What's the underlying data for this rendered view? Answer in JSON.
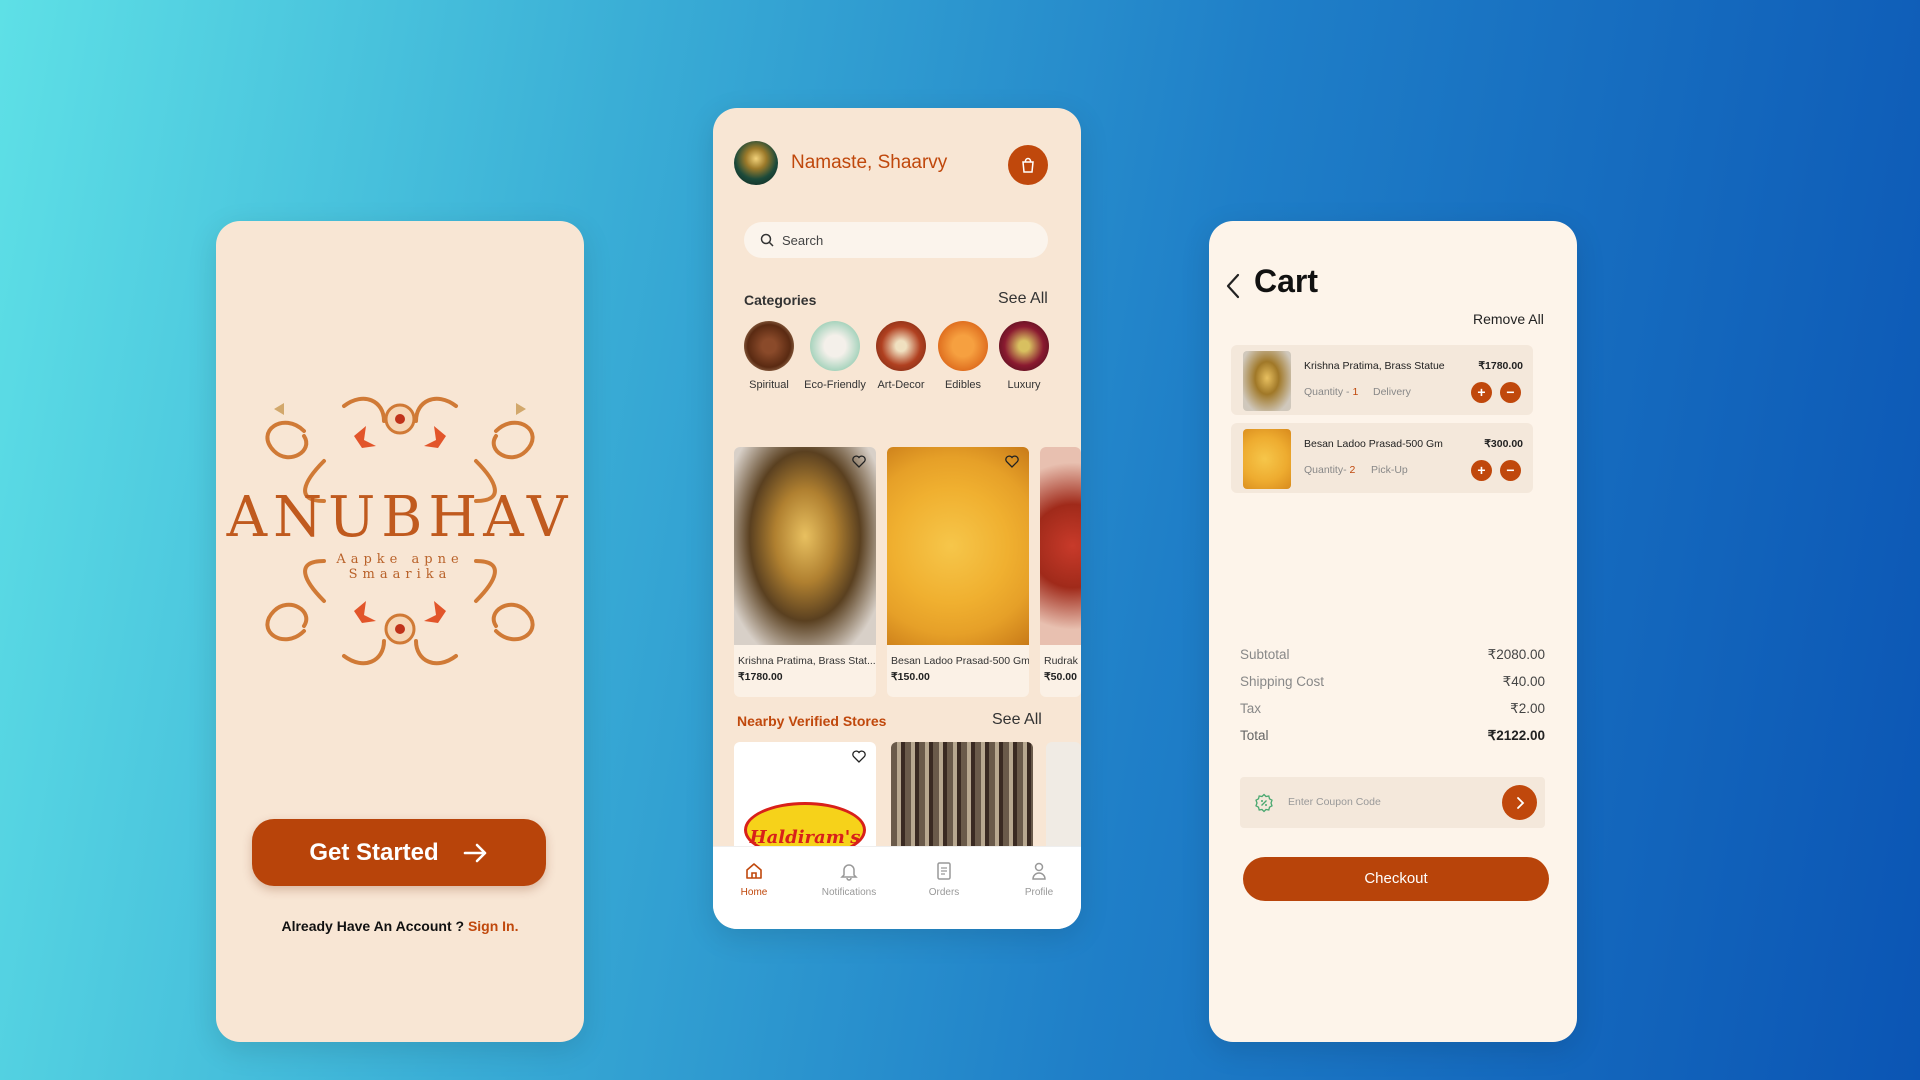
{
  "splash": {
    "brand": "ANUBHAV",
    "tagline_line1": "Aapke apne",
    "tagline_line2": "Smaarika",
    "get_started": "Get Started",
    "account_prompt": "Already Have An Account ?",
    "sign_in": "Sign In."
  },
  "home": {
    "greeting": "Namaste, Shaarvy",
    "search_placeholder": "Search",
    "categories_title": "Categories",
    "see_all": "See All",
    "categories": [
      "Spiritual",
      "Eco-Friendly",
      "Art-Decor",
      "Edibles",
      "Luxury"
    ],
    "products": [
      {
        "name": "Krishna Pratima, Brass Stat...",
        "price": "₹1780.00"
      },
      {
        "name": "Besan Ladoo Prasad-500 Gm",
        "price": "₹150.00"
      },
      {
        "name": "Rudrak",
        "price": "₹50.00"
      }
    ],
    "stores_title": "Nearby Verified Stores",
    "stores_see_all": "See All",
    "store_logo_text": "Haldiram's",
    "nav": [
      "Home",
      "Notifications",
      "Orders",
      "Profile"
    ]
  },
  "cart": {
    "title": "Cart",
    "remove_all": "Remove All",
    "items": [
      {
        "name": "Krishna Pratima, Brass Statue",
        "price": "₹1780.00",
        "qty_label": "Quantity - ",
        "qty": "1",
        "mode": "Delivery"
      },
      {
        "name": "Besan Ladoo Prasad-500 Gm",
        "price": "₹300.00",
        "qty_label": "Quantity- ",
        "qty": "2",
        "mode": "Pick-Up"
      }
    ],
    "summary": {
      "subtotal_label": "Subtotal",
      "subtotal": "₹2080.00",
      "shipping_label": "Shipping Cost",
      "shipping": "₹40.00",
      "tax_label": "Tax",
      "tax": "₹2.00",
      "total_label": "Total",
      "total": "₹2122.00"
    },
    "coupon_placeholder": "Enter Coupon Code",
    "checkout": "Checkout"
  },
  "colors": {
    "accent": "#c0480c",
    "button": "#b8440a",
    "screen_bg": "#f8e6d4",
    "cart_bg": "#fdf4ea"
  }
}
